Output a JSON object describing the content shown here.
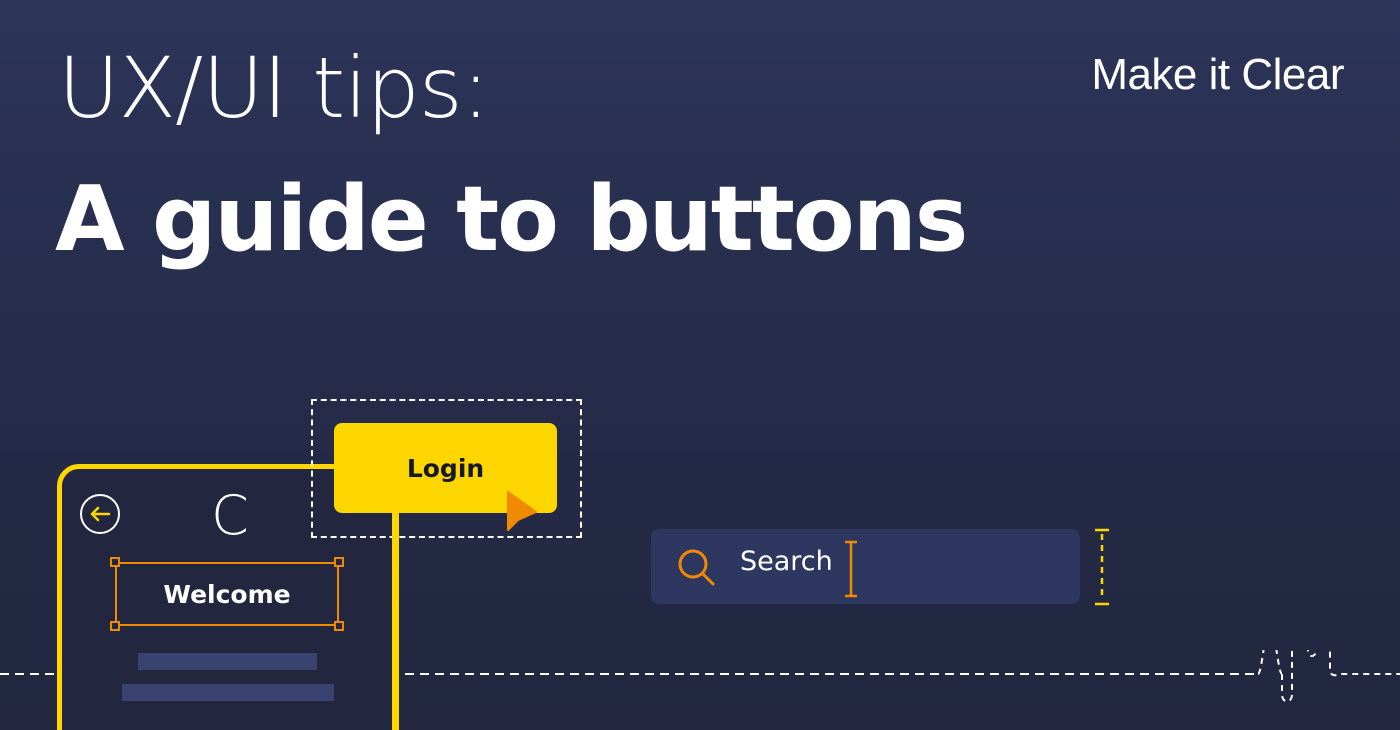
{
  "header": {
    "title_line1": "UX/UI tips:",
    "title_line2": "A guide to buttons",
    "brand": "Make it Clear"
  },
  "phone": {
    "logo_letter": "C",
    "welcome_label": "Welcome"
  },
  "login": {
    "label": "Login"
  },
  "search": {
    "label": "Search"
  },
  "colors": {
    "background": "#2a3152",
    "accent_yellow": "#fdd600",
    "accent_orange": "#f08a00",
    "text": "#ffffff"
  },
  "icons": [
    "back-arrow-icon",
    "search-icon",
    "pointer-cursor-icon",
    "text-caret-icon"
  ]
}
